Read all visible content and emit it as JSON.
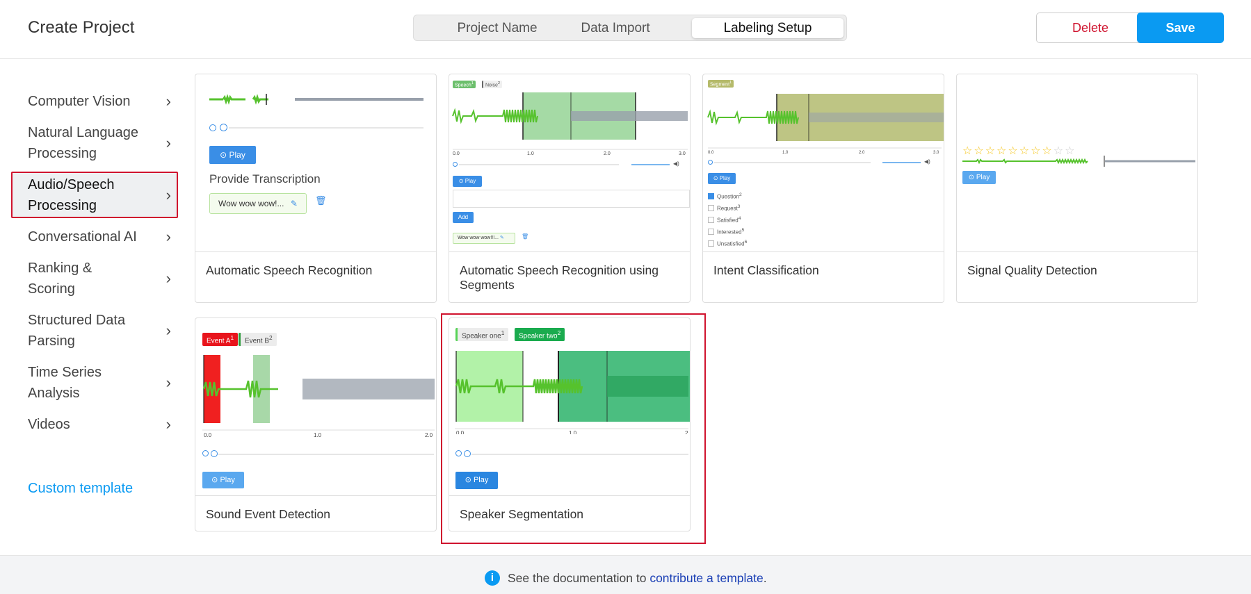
{
  "header": {
    "title": "Create Project",
    "steps": [
      "Project Name",
      "Data Import",
      "Labeling Setup"
    ],
    "active_step": "Labeling Setup",
    "delete_label": "Delete",
    "save_label": "Save"
  },
  "sidebar": {
    "items": [
      {
        "label": "Computer Vision"
      },
      {
        "label": "Natural Language Processing"
      },
      {
        "label": "Audio/Speech Processing",
        "selected": true
      },
      {
        "label": "Conversational AI"
      },
      {
        "label": "Ranking & Scoring"
      },
      {
        "label": "Structured Data Parsing"
      },
      {
        "label": "Time Series Analysis"
      },
      {
        "label": "Videos"
      }
    ],
    "custom_template": "Custom template"
  },
  "cards": [
    {
      "title": "Automatic Speech Recognition",
      "preview": {
        "play": "Play",
        "heading": "Provide Transcription",
        "text": "Wow wow wow!..."
      }
    },
    {
      "title": "Automatic Speech Recognition using Segments",
      "preview": {
        "tags": [
          "Speech",
          "Noise"
        ],
        "tag_keys": [
          "1",
          "2"
        ],
        "play": "Play",
        "add": "Add",
        "text": "Wow wow wow!!!...",
        "ticks": [
          "0.0",
          "1.0",
          "2.0",
          "3.0"
        ]
      }
    },
    {
      "title": "Intent Classification",
      "preview": {
        "tag": "Segment",
        "tag_key": "1",
        "play": "Play",
        "options": [
          {
            "label": "Question",
            "key": "2",
            "checked": true
          },
          {
            "label": "Request",
            "key": "3",
            "checked": false
          },
          {
            "label": "Satisfied",
            "key": "4",
            "checked": false
          },
          {
            "label": "Interested",
            "key": "5",
            "checked": false
          },
          {
            "label": "Unsatisfied",
            "key": "6",
            "checked": false
          }
        ],
        "ticks": [
          "0.0",
          "1.0",
          "2.0",
          "3.0"
        ]
      }
    },
    {
      "title": "Signal Quality Detection",
      "preview": {
        "play": "Play",
        "rating": 8,
        "max_rating": 10
      }
    },
    {
      "title": "Sound Event Detection",
      "preview": {
        "tags": [
          "Event A",
          "Event B"
        ],
        "tag_keys": [
          "1",
          "2"
        ],
        "play": "Play",
        "ticks": [
          "0.0",
          "1.0",
          "2.0"
        ]
      }
    },
    {
      "title": "Speaker Segmentation",
      "selected": true,
      "preview": {
        "tags": [
          "Speaker one",
          "Speaker two"
        ],
        "tag_keys": [
          "1",
          "2"
        ],
        "play": "Play",
        "ticks": [
          "0.0",
          "1.0",
          "2"
        ]
      }
    }
  ],
  "footer": {
    "text": "See the documentation to ",
    "link": "contribute a template",
    "end": "."
  },
  "colors": {
    "primary": "#0a9af2",
    "danger": "#d0132e",
    "wave_green": "#56c22d",
    "wave_gray": "#98a0ab"
  }
}
